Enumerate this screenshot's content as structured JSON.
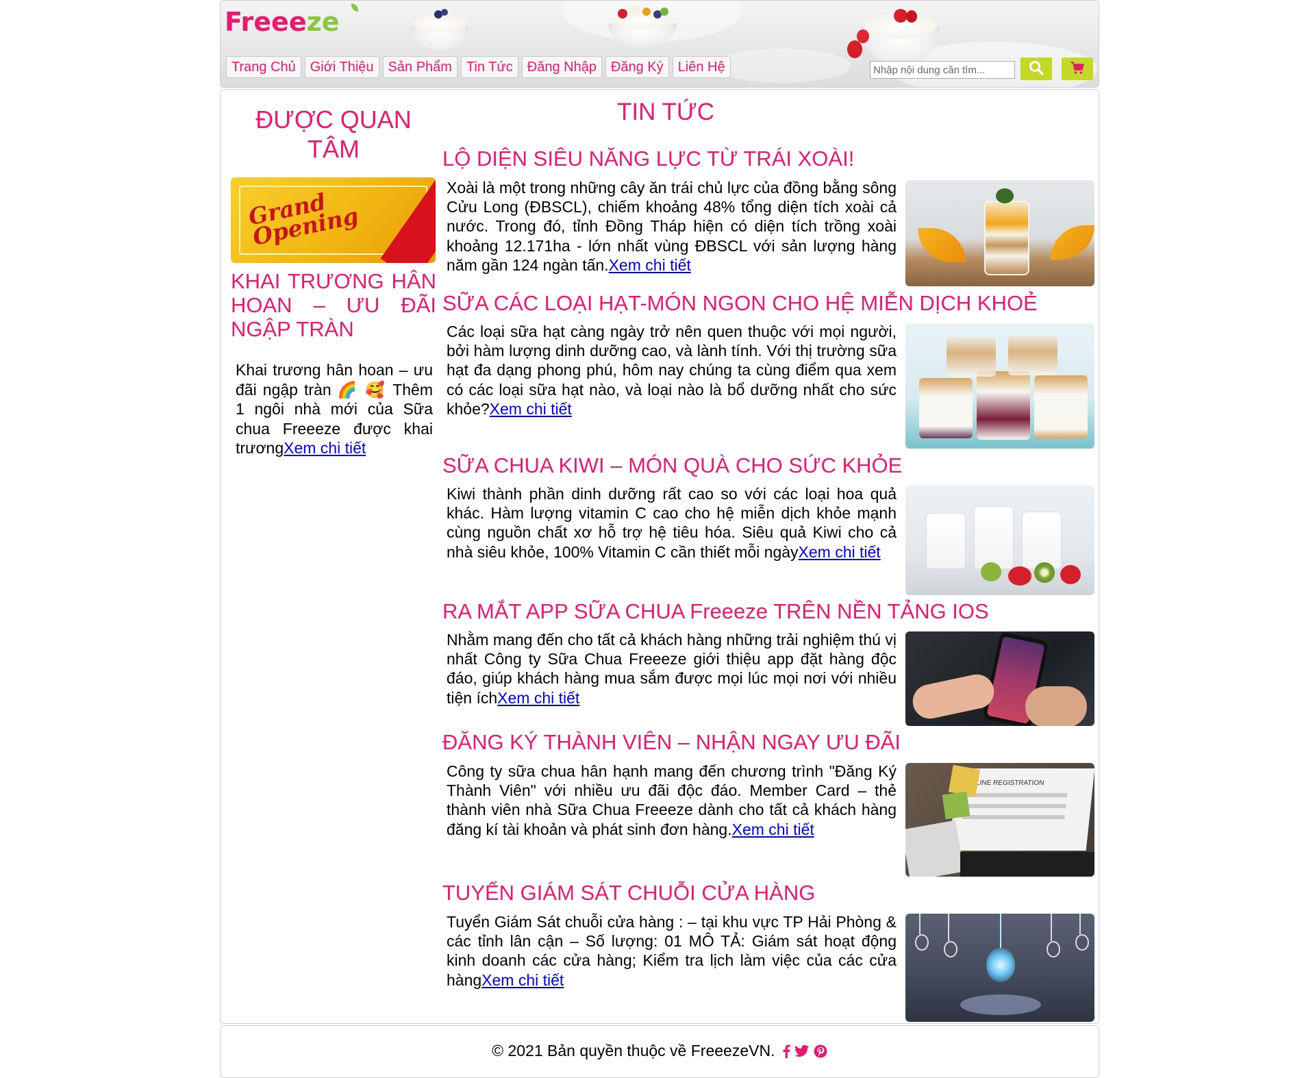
{
  "brand": {
    "logo_text": "Free",
    "logo_text_accent": "ze",
    "logo_text_mid": "e",
    "primary_color": "#e8196f",
    "accent_color": "#c2d927",
    "leaf_color": "#8cc63f"
  },
  "nav": {
    "items": [
      {
        "label": "Trang Chủ"
      },
      {
        "label": "Giới Thiệu"
      },
      {
        "label": "Sản Phẩm"
      },
      {
        "label": "Tin Tức"
      },
      {
        "label": "Đăng Nhập"
      },
      {
        "label": "Đăng Ký"
      },
      {
        "label": "Liên Hệ"
      }
    ]
  },
  "search": {
    "placeholder": "Nhập nội dung cần tìm...",
    "button_icon": "search-icon",
    "cart_icon": "cart-icon"
  },
  "sidebar": {
    "title": "ĐƯỢC QUAN TÂM",
    "image_text": "Grand Opening",
    "post_title": "KHAI TRƯƠNG HÂN HOAN – ƯU ĐÃI NGẬP TRÀN",
    "post_text": "Khai trương hân hoan – ưu đãi ngập tràn 🌈 🥰 Thêm 1 ngôi nhà mới của Sữa chua Freeeze được khai trương",
    "post_link": "Xem chi tiết"
  },
  "news": {
    "title": "TIN TỨC",
    "articles": [
      {
        "title": "LỘ DIỆN SIÊU NĂNG LỰC TỪ TRÁI XOÀI!",
        "text": "Xoài là một trong những cây ăn trái chủ lực của đồng bằng sông Cửu Long (ĐBSCL), chiếm khoảng 48% tổng diện tích xoài cả nước. Trong đó, tỉnh Đồng Tháp hiện có diện tích trồng xoài khoảng 12.171ha - lớn nhất vùng ĐBSCL với sản lượng hàng năm gần 124 ngàn tấn.",
        "link": "Xem chi tiết"
      },
      {
        "title": "SỮA CÁC LOẠI HẠT-MÓN NGON CHO HỆ MIỄN DỊCH KHOẺ",
        "text": "Các loại sữa hạt càng ngày trở nên quen thuộc với mọi người, bởi hàm lượng dinh dưỡng cao, và lành tính. Với thị trường sữa hạt đa dạng phong phú, hôm nay chúng ta cùng điểm qua xem có các loại sữa hạt nào, và loại nào là bổ dưỡng nhất cho sức khỏe?",
        "link": "Xem chi tiết"
      },
      {
        "title": "SỮA CHUA KIWI – MÓN QUÀ CHO SỨC KHỎE",
        "text": "Kiwi thành phần dinh dưỡng rất cao so với các loại hoa quả khác. Hàm lượng vitamin C cao cho hệ miễn dịch khỏe mạnh cùng nguồn chất xơ hỗ trợ hệ tiêu hóa. Siêu quả Kiwi cho cả nhà siêu khỏe, 100% Vitamin C cần thiết mỗi ngày",
        "link": "Xem chi tiết"
      },
      {
        "title": "RA MẮT APP SỮA CHUA Freeeze TRÊN NỀN TẢNG IOS",
        "text": "Nhằm mang đến cho tất cả khách hàng những trải nghiệm thú vị nhất Công ty Sữa Chua Freeeze giới thiệu app đặt hàng độc đáo, giúp khách hàng mua sắm được mọi lúc mọi nơi với nhiều tiện ích",
        "link": "Xem chi tiết"
      },
      {
        "title": "ĐĂNG KÝ THÀNH VIÊN – NHẬN NGAY ƯU ĐÃI",
        "text": "Công ty sữa chua hân hạnh mang đến chương trình \"Đăng Ký Thành Viên\" với nhiều ưu đãi độc đáo. Member Card – thẻ thành viên nhà Sữa Chua Freeeze dành cho tất cả khách hàng đăng kí tài khoản và phát sinh đơn hàng.",
        "link": "Xem chi tiết",
        "image_text": "ONLINE REGISTRATION"
      },
      {
        "title": "TUYỂN GIÁM SÁT CHUỖI CỬA HÀNG",
        "text": "Tuyển Giám Sát chuỗi cửa hàng : – tại khu vực TP Hải Phòng & các tỉnh lân cận – Số lượng: 01 MÔ TẢ: Giám sát hoạt động kinh doanh các cửa hàng; Kiểm tra lịch làm việc của các cửa hàng",
        "link": "Xem chi tiết"
      }
    ]
  },
  "footer": {
    "copyright": "© 2021 Bản quyền thuộc về FreeezeVN.",
    "social_icons": [
      "facebook-icon",
      "twitter-icon",
      "pinterest-icon"
    ]
  }
}
